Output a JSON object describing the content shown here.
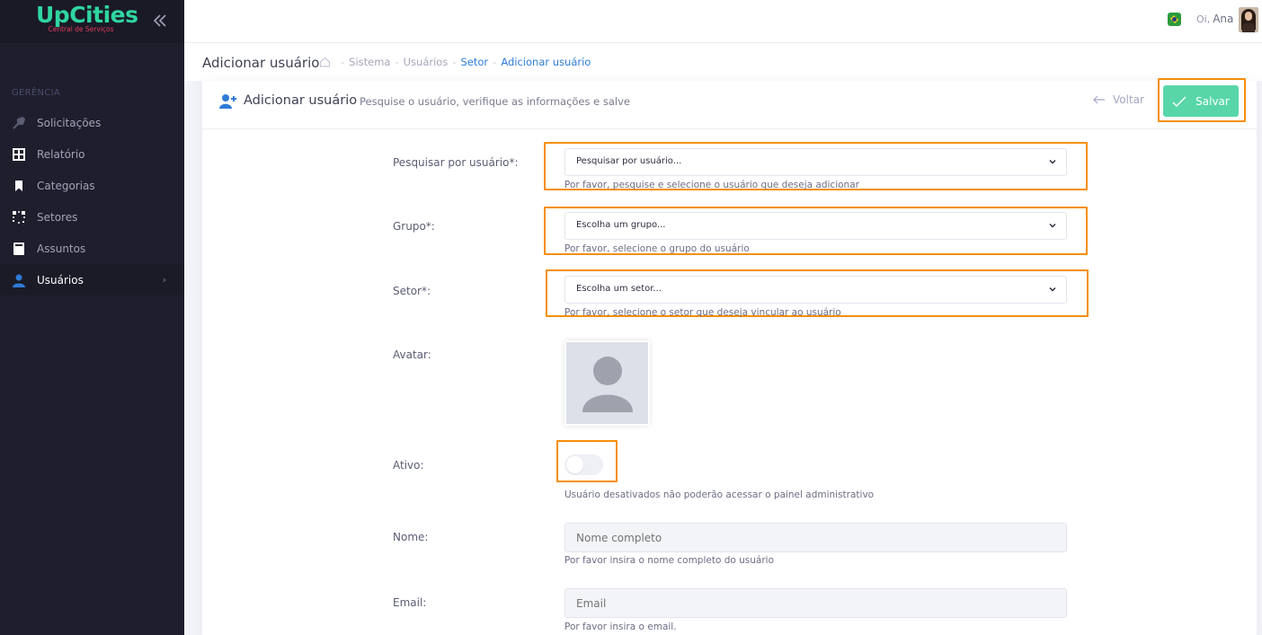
{
  "app": {
    "brand_name": "UpCities",
    "brand_tagline": "Central de Serviços"
  },
  "sidebar": {
    "section_title": "GERÊNCIA",
    "items": [
      {
        "label": "Solicitações",
        "icon": "wrench-icon"
      },
      {
        "label": "Relatório",
        "icon": "grid-icon"
      },
      {
        "label": "Categorias",
        "icon": "bookmark-icon"
      },
      {
        "label": "Setores",
        "icon": "dotted-square-icon"
      },
      {
        "label": "Assuntos",
        "icon": "document-icon"
      },
      {
        "label": "Usuários",
        "icon": "user-icon",
        "active": true
      }
    ]
  },
  "header": {
    "greeting": "Oi,",
    "user_name": "Ana",
    "language_icon": "brazil-flag-icon"
  },
  "subheader": {
    "page_title": "Adicionar usuário",
    "breadcrumb": [
      "Sistema",
      "Usuários",
      "Setor",
      "Adicionar usuário"
    ]
  },
  "form": {
    "title": "Adicionar usuário",
    "description": "Pesquise o usuário, verifique as informações e salve",
    "back_label": "Voltar",
    "save_label": "Salvar",
    "search_user": {
      "label": "Pesquisar por usuário*:",
      "value": "Pesquisar por usuário...",
      "help": "Por favor, pesquise e selecione o usuário que deseja adicionar"
    },
    "group": {
      "label": "Grupo*:",
      "value": "Escolha um grupo...",
      "help": "Por favor, selecione o grupo do usuário"
    },
    "sector": {
      "label": "Setor*:",
      "value": "Escolha um setor...",
      "help": "Por favor, selecione o setor que deseja vincular ao usuário"
    },
    "avatar": {
      "label": "Avatar:"
    },
    "active": {
      "label": "Ativo:",
      "checked": false,
      "help": "Usuário desativados não poderão acessar o painel administrativo"
    },
    "name": {
      "label": "Nome:",
      "placeholder": "Nome completo",
      "help": "Por favor insira o nome completo do usuário"
    },
    "email": {
      "label": "Email:",
      "placeholder": "Email",
      "help": "Por favor insira o email."
    }
  },
  "colors": {
    "sidebar_bg": "#1e1e2d",
    "brand_green": "#2fd6a0",
    "save_button": "#58d6a8",
    "highlight": "#f58f0a",
    "link_blue": "#2e7bd6"
  }
}
